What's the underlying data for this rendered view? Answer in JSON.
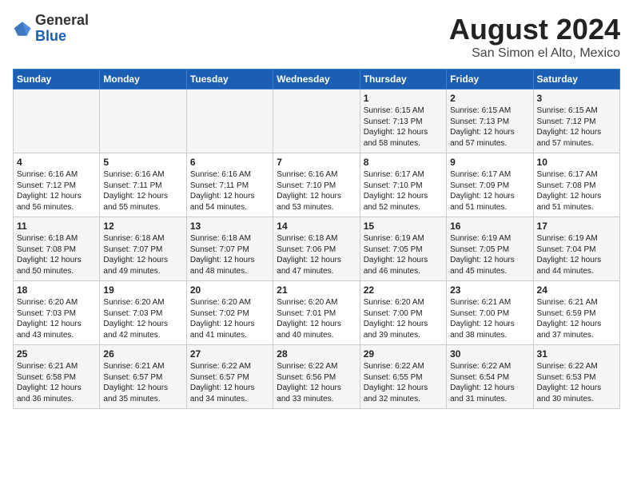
{
  "header": {
    "logo_line1": "General",
    "logo_line2": "Blue",
    "title": "August 2024",
    "subtitle": "San Simon el Alto, Mexico"
  },
  "days_of_week": [
    "Sunday",
    "Monday",
    "Tuesday",
    "Wednesday",
    "Thursday",
    "Friday",
    "Saturday"
  ],
  "weeks": [
    [
      {
        "day": "",
        "content": ""
      },
      {
        "day": "",
        "content": ""
      },
      {
        "day": "",
        "content": ""
      },
      {
        "day": "",
        "content": ""
      },
      {
        "day": "1",
        "content": "Sunrise: 6:15 AM\nSunset: 7:13 PM\nDaylight: 12 hours\nand 58 minutes."
      },
      {
        "day": "2",
        "content": "Sunrise: 6:15 AM\nSunset: 7:13 PM\nDaylight: 12 hours\nand 57 minutes."
      },
      {
        "day": "3",
        "content": "Sunrise: 6:15 AM\nSunset: 7:12 PM\nDaylight: 12 hours\nand 57 minutes."
      }
    ],
    [
      {
        "day": "4",
        "content": "Sunrise: 6:16 AM\nSunset: 7:12 PM\nDaylight: 12 hours\nand 56 minutes."
      },
      {
        "day": "5",
        "content": "Sunrise: 6:16 AM\nSunset: 7:11 PM\nDaylight: 12 hours\nand 55 minutes."
      },
      {
        "day": "6",
        "content": "Sunrise: 6:16 AM\nSunset: 7:11 PM\nDaylight: 12 hours\nand 54 minutes."
      },
      {
        "day": "7",
        "content": "Sunrise: 6:16 AM\nSunset: 7:10 PM\nDaylight: 12 hours\nand 53 minutes."
      },
      {
        "day": "8",
        "content": "Sunrise: 6:17 AM\nSunset: 7:10 PM\nDaylight: 12 hours\nand 52 minutes."
      },
      {
        "day": "9",
        "content": "Sunrise: 6:17 AM\nSunset: 7:09 PM\nDaylight: 12 hours\nand 51 minutes."
      },
      {
        "day": "10",
        "content": "Sunrise: 6:17 AM\nSunset: 7:08 PM\nDaylight: 12 hours\nand 51 minutes."
      }
    ],
    [
      {
        "day": "11",
        "content": "Sunrise: 6:18 AM\nSunset: 7:08 PM\nDaylight: 12 hours\nand 50 minutes."
      },
      {
        "day": "12",
        "content": "Sunrise: 6:18 AM\nSunset: 7:07 PM\nDaylight: 12 hours\nand 49 minutes."
      },
      {
        "day": "13",
        "content": "Sunrise: 6:18 AM\nSunset: 7:07 PM\nDaylight: 12 hours\nand 48 minutes."
      },
      {
        "day": "14",
        "content": "Sunrise: 6:18 AM\nSunset: 7:06 PM\nDaylight: 12 hours\nand 47 minutes."
      },
      {
        "day": "15",
        "content": "Sunrise: 6:19 AM\nSunset: 7:05 PM\nDaylight: 12 hours\nand 46 minutes."
      },
      {
        "day": "16",
        "content": "Sunrise: 6:19 AM\nSunset: 7:05 PM\nDaylight: 12 hours\nand 45 minutes."
      },
      {
        "day": "17",
        "content": "Sunrise: 6:19 AM\nSunset: 7:04 PM\nDaylight: 12 hours\nand 44 minutes."
      }
    ],
    [
      {
        "day": "18",
        "content": "Sunrise: 6:20 AM\nSunset: 7:03 PM\nDaylight: 12 hours\nand 43 minutes."
      },
      {
        "day": "19",
        "content": "Sunrise: 6:20 AM\nSunset: 7:03 PM\nDaylight: 12 hours\nand 42 minutes."
      },
      {
        "day": "20",
        "content": "Sunrise: 6:20 AM\nSunset: 7:02 PM\nDaylight: 12 hours\nand 41 minutes."
      },
      {
        "day": "21",
        "content": "Sunrise: 6:20 AM\nSunset: 7:01 PM\nDaylight: 12 hours\nand 40 minutes."
      },
      {
        "day": "22",
        "content": "Sunrise: 6:20 AM\nSunset: 7:00 PM\nDaylight: 12 hours\nand 39 minutes."
      },
      {
        "day": "23",
        "content": "Sunrise: 6:21 AM\nSunset: 7:00 PM\nDaylight: 12 hours\nand 38 minutes."
      },
      {
        "day": "24",
        "content": "Sunrise: 6:21 AM\nSunset: 6:59 PM\nDaylight: 12 hours\nand 37 minutes."
      }
    ],
    [
      {
        "day": "25",
        "content": "Sunrise: 6:21 AM\nSunset: 6:58 PM\nDaylight: 12 hours\nand 36 minutes."
      },
      {
        "day": "26",
        "content": "Sunrise: 6:21 AM\nSunset: 6:57 PM\nDaylight: 12 hours\nand 35 minutes."
      },
      {
        "day": "27",
        "content": "Sunrise: 6:22 AM\nSunset: 6:57 PM\nDaylight: 12 hours\nand 34 minutes."
      },
      {
        "day": "28",
        "content": "Sunrise: 6:22 AM\nSunset: 6:56 PM\nDaylight: 12 hours\nand 33 minutes."
      },
      {
        "day": "29",
        "content": "Sunrise: 6:22 AM\nSunset: 6:55 PM\nDaylight: 12 hours\nand 32 minutes."
      },
      {
        "day": "30",
        "content": "Sunrise: 6:22 AM\nSunset: 6:54 PM\nDaylight: 12 hours\nand 31 minutes."
      },
      {
        "day": "31",
        "content": "Sunrise: 6:22 AM\nSunset: 6:53 PM\nDaylight: 12 hours\nand 30 minutes."
      }
    ]
  ]
}
